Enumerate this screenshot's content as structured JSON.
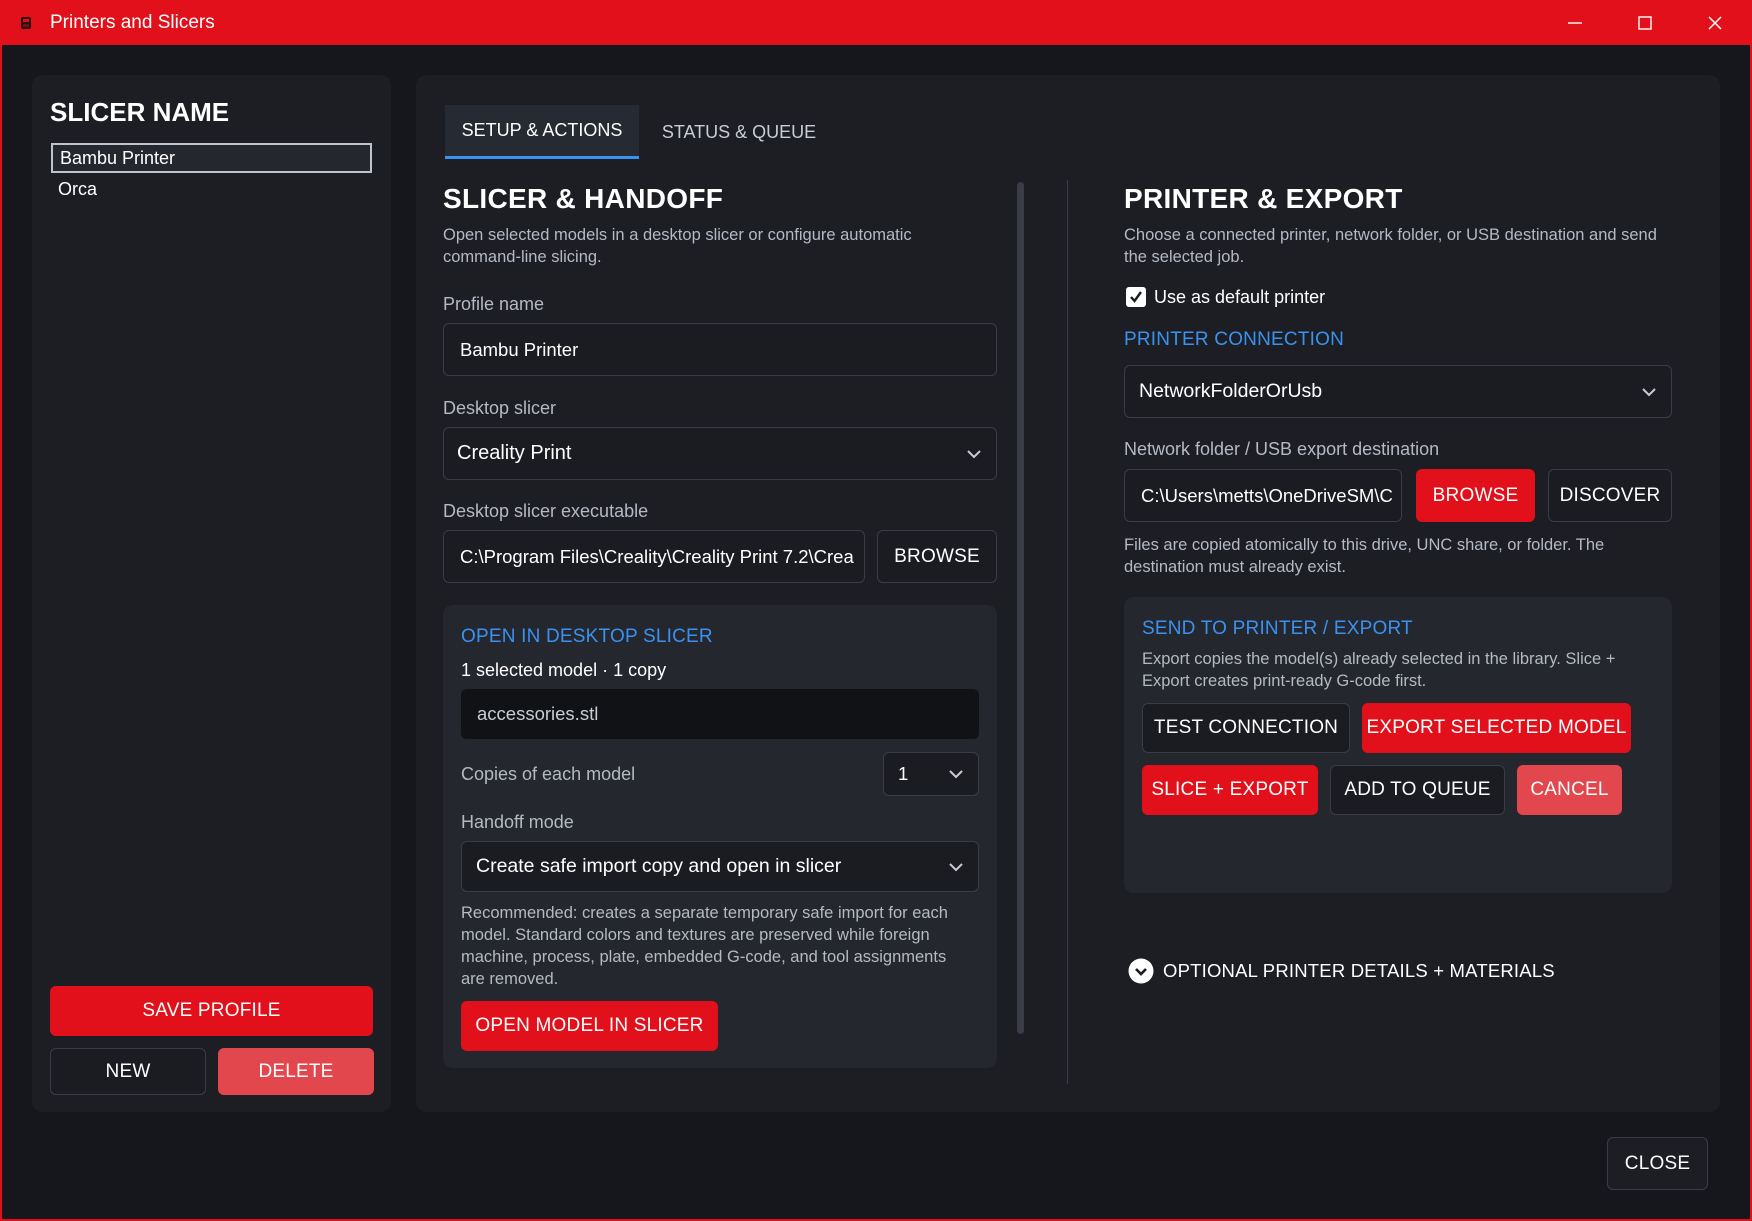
{
  "window": {
    "title": "Printers and Slicers"
  },
  "sidebar": {
    "heading": "SLICER NAME",
    "items": [
      {
        "label": "Bambu Printer",
        "selected": true
      },
      {
        "label": "Orca",
        "selected": false
      }
    ],
    "save_label": "SAVE PROFILE",
    "new_label": "NEW",
    "delete_label": "DELETE"
  },
  "tabs": [
    {
      "label": "SETUP & ACTIONS",
      "active": true
    },
    {
      "label": "STATUS & QUEUE",
      "active": false
    }
  ],
  "slicer": {
    "title": "SLICER & HANDOFF",
    "description": "Open selected models in a desktop slicer or configure automatic command-line slicing.",
    "profile_label": "Profile name",
    "profile_value": "Bambu Printer",
    "desktop_slicer_label": "Desktop slicer",
    "desktop_slicer_value": "Creality Print",
    "executable_label": "Desktop slicer executable",
    "executable_value": "C:\\Program Files\\Creality\\Creality Print 7.2\\Crea",
    "browse_label": "BROWSE",
    "open": {
      "heading": "OPEN IN DESKTOP SLICER",
      "summary": "1 selected model · 1 copy",
      "file": "accessories.stl",
      "copies_label": "Copies of each model",
      "copies_value": "1",
      "handoff_label": "Handoff mode",
      "handoff_value": "Create safe import copy and open in slicer",
      "recommendation": "Recommended: creates a separate temporary safe import for each model. Standard colors and textures are preserved while foreign machine, process, plate, embedded G-code, and tool assignments are removed.",
      "open_button": "OPEN MODEL IN SLICER"
    }
  },
  "printer": {
    "title": "PRINTER & EXPORT",
    "description": "Choose a connected printer, network folder, or USB destination and send the selected job.",
    "default_label": "Use as default printer",
    "default_checked": true,
    "connection_heading": "PRINTER CONNECTION",
    "connection_value": "NetworkFolderOrUsb",
    "dest_label": "Network folder / USB export destination",
    "dest_value": "C:\\Users\\metts\\OneDriveSM\\C",
    "browse_label": "BROWSE",
    "discover_label": "DISCOVER",
    "dest_note": "Files are copied atomically to this drive, UNC share, or folder. The destination must already exist.",
    "send": {
      "heading": "SEND TO PRINTER / EXPORT",
      "description": "Export copies the model(s) already selected in the library. Slice + Export creates print-ready G-code first.",
      "test_label": "TEST CONNECTION",
      "export_label": "EXPORT SELECTED MODEL",
      "slice_export_label": "SLICE + EXPORT",
      "add_queue_label": "ADD TO QUEUE",
      "cancel_label": "CANCEL"
    },
    "optional_label": "OPTIONAL PRINTER DETAILS + MATERIALS"
  },
  "footer": {
    "close_label": "CLOSE"
  },
  "colors": {
    "accent_red": "#e1101a",
    "accent_blue": "#3b91f0",
    "pink": "#e2474e"
  }
}
